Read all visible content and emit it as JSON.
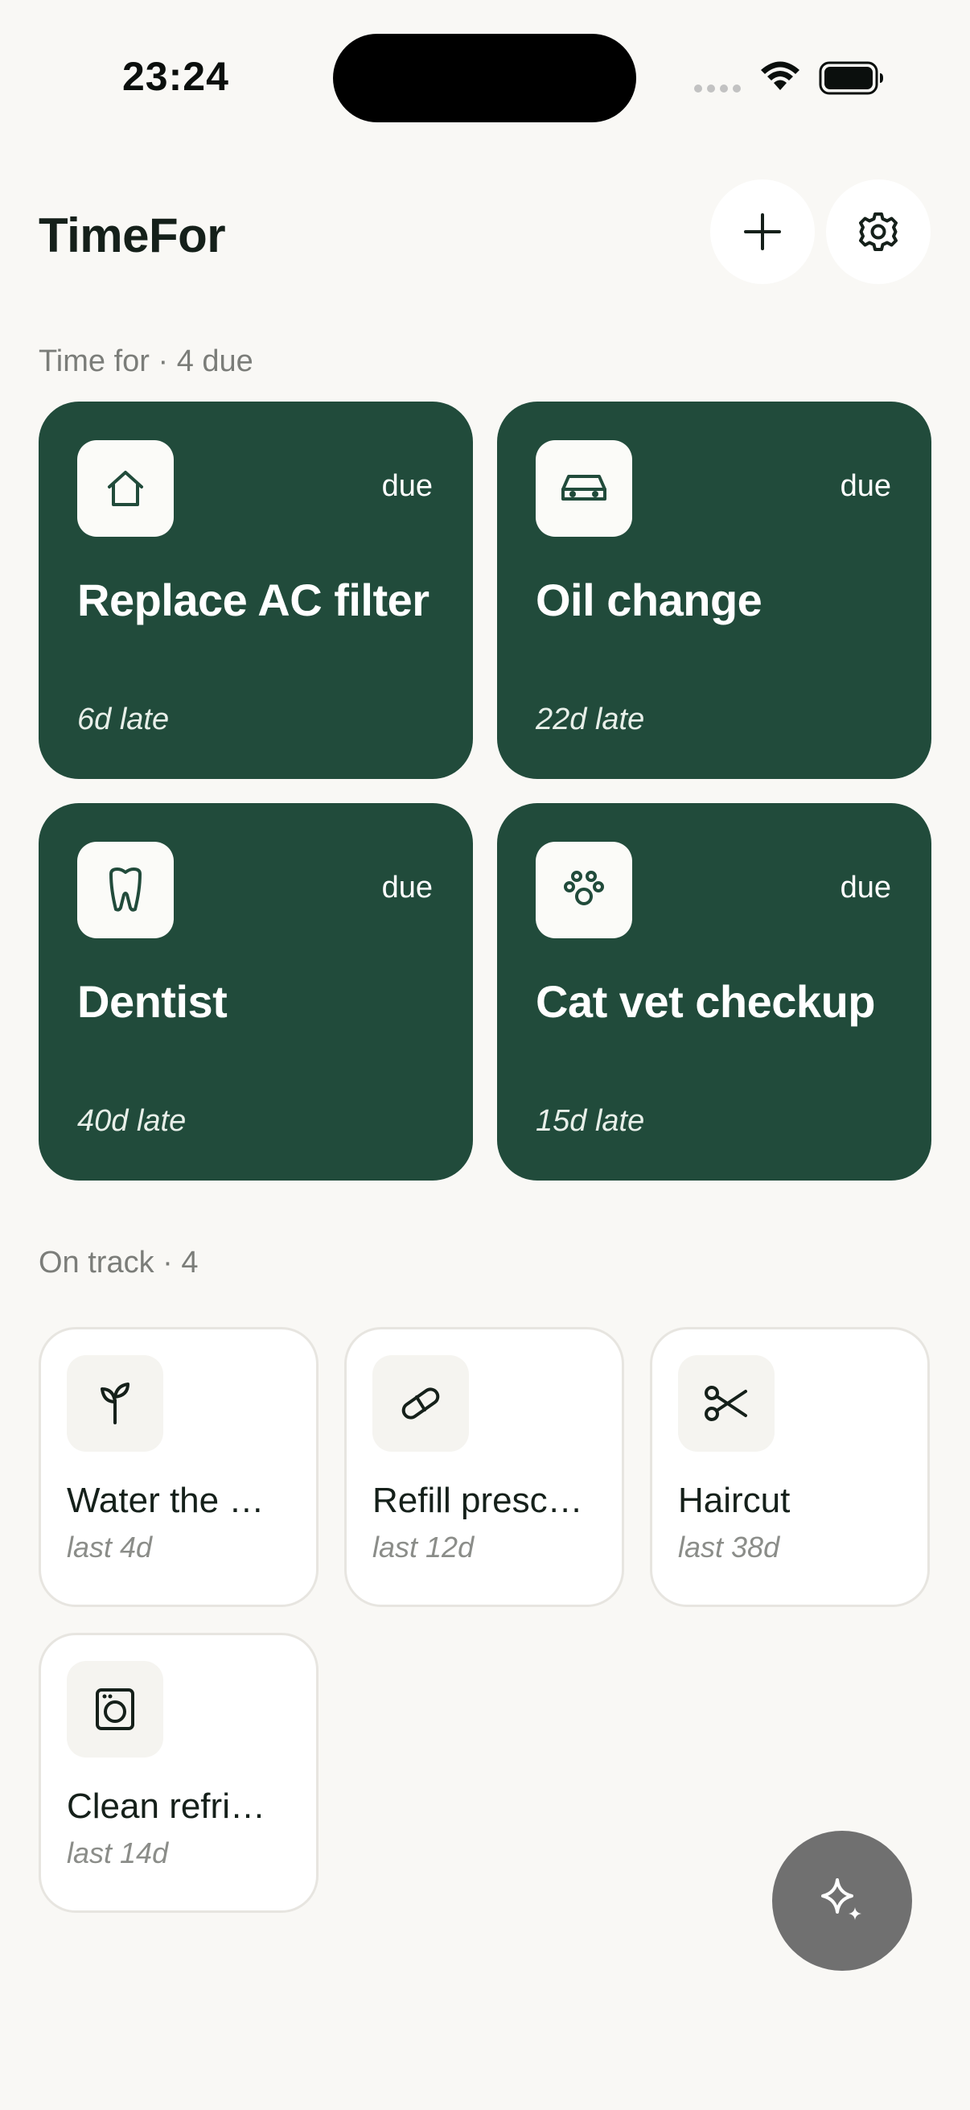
{
  "status": {
    "time": "23:24"
  },
  "header": {
    "title": "TimeFor"
  },
  "sections": {
    "due_label": "Time for · 4 due",
    "track_label": "On track · 4"
  },
  "due_items": [
    {
      "title": "Replace AC filter",
      "status": "due",
      "late": "6d late",
      "icon": "home-icon"
    },
    {
      "title": "Oil change",
      "status": "due",
      "late": "22d late",
      "icon": "car-icon"
    },
    {
      "title": "Dentist",
      "status": "due",
      "late": "40d late",
      "icon": "tooth-icon"
    },
    {
      "title": "Cat vet checkup",
      "status": "due",
      "late": "15d late",
      "icon": "paw-icon"
    }
  ],
  "track_items": [
    {
      "title": "Water the …",
      "last": "last 4d",
      "icon": "sprout-icon"
    },
    {
      "title": "Refill presc…",
      "last": "last 12d",
      "icon": "pill-icon"
    },
    {
      "title": "Haircut",
      "last": "last 38d",
      "icon": "scissors-icon"
    },
    {
      "title": "Clean refri…",
      "last": "last 14d",
      "icon": "appliance-icon"
    }
  ],
  "colors": {
    "background": "#f9f8f5",
    "due_card": "#214b3b",
    "fab": "#707070"
  }
}
